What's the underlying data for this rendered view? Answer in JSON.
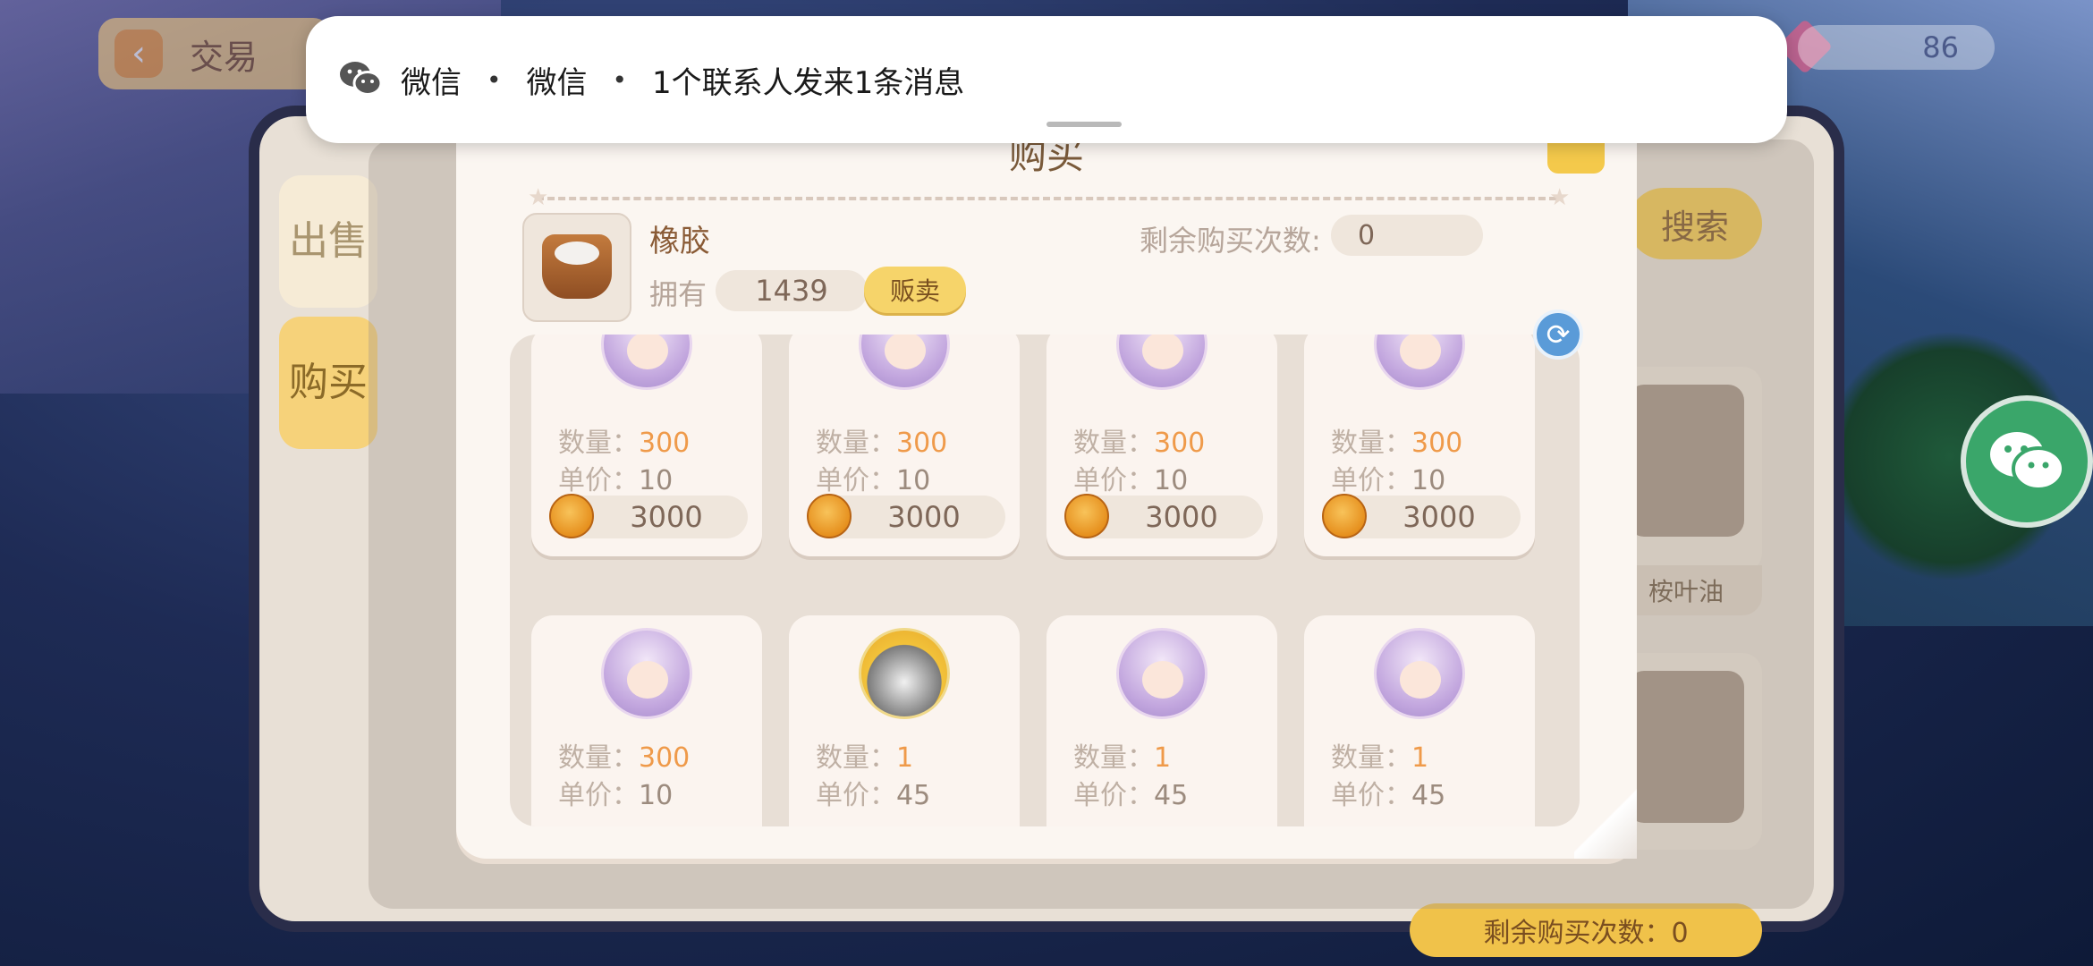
{
  "notification": {
    "app1": "微信",
    "app2": "微信",
    "separator": "•",
    "message": "1个联系人发来1条消息"
  },
  "background": {
    "top_title": "交易",
    "currency_value": "86",
    "side_tabs": [
      "出售",
      "购买"
    ],
    "search_label": "搜索",
    "card_label": "桉叶油",
    "remain_label": "剩余购买次数：0"
  },
  "dialog": {
    "title": "购买",
    "item_name": "橡胶",
    "own_label": "拥有",
    "own_value": "1439",
    "sell_button": "贩卖",
    "remain_label": "剩余购买次数:",
    "remain_value": "0"
  },
  "listings": [
    {
      "qty_label": "数量：",
      "qty": "300",
      "price_label": "单价：",
      "price": "10",
      "total": "3000",
      "avatar": "girl-avatar"
    },
    {
      "qty_label": "数量：",
      "qty": "300",
      "price_label": "单价：",
      "price": "10",
      "total": "3000",
      "avatar": "girl-avatar"
    },
    {
      "qty_label": "数量：",
      "qty": "300",
      "price_label": "单价：",
      "price": "10",
      "total": "3000",
      "avatar": "girl-avatar"
    },
    {
      "qty_label": "数量：",
      "qty": "300",
      "price_label": "单价：",
      "price": "10",
      "total": "3000",
      "avatar": "girl-avatar"
    },
    {
      "qty_label": "数量：",
      "qty": "300",
      "price_label": "单价：",
      "price": "10",
      "avatar": "girl-avatar"
    },
    {
      "qty_label": "数量：",
      "qty": "1",
      "price_label": "单价：",
      "price": "45",
      "avatar": "raccoon-avatar"
    },
    {
      "qty_label": "数量：",
      "qty": "1",
      "price_label": "单价：",
      "price": "45",
      "avatar": "girl-avatar"
    },
    {
      "qty_label": "数量：",
      "qty": "1",
      "price_label": "单价：",
      "price": "45",
      "avatar": "girl-avatar"
    }
  ],
  "colors": {
    "accent_orange": "#ef9a4a",
    "button_yellow": "#f6d46a",
    "wechat_green": "#3aa66a"
  }
}
